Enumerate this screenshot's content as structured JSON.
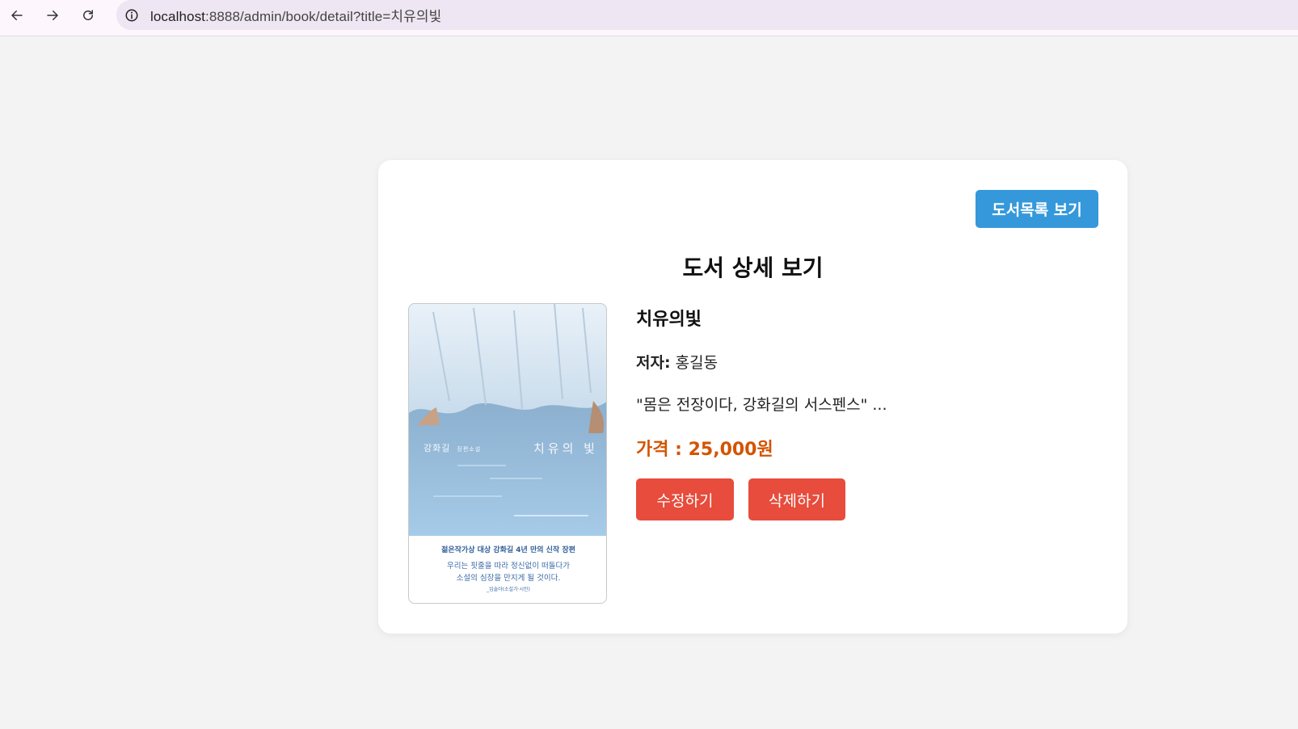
{
  "browser": {
    "url_host": "localhost",
    "url_rest": ":8888/admin/book/detail?title=치유의빛"
  },
  "card": {
    "list_button": "도서목록 보기",
    "page_title": "도서 상세 보기"
  },
  "book": {
    "title": "치유의빛",
    "author_label": "저자:",
    "author": "홍길동",
    "description": "\"몸은 전장이다, 강화길의 서스펜스\" ...",
    "price_text": "가격 : 25,000원"
  },
  "cover": {
    "author": "강화길",
    "genre": "장편소설",
    "title": "치유의 빛",
    "tagline": "젊은작가상 대상 강화길 4년 만의 신작 장편",
    "quote_line1": "우리는 핏줄을 따라 정신없이 떠돌다가",
    "quote_line2": "소설의 심장을 만지게 될 것이다.",
    "blurb_signature": "_임솔아(소설가·시인)"
  },
  "actions": {
    "edit": "수정하기",
    "delete": "삭제하기"
  },
  "colors": {
    "primary": "#3498db",
    "danger": "#e74c3c",
    "price": "#d35400"
  }
}
